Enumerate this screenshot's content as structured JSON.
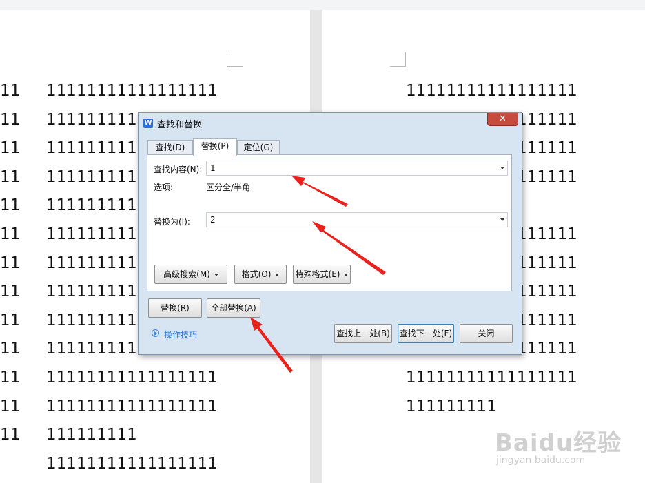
{
  "document": {
    "left_page_lines": [
      {
        "prefix": "11",
        "text": "11111111111111111"
      },
      {
        "prefix": "11",
        "text": "11111111111111111"
      },
      {
        "prefix": "11",
        "text": "11111111111111111"
      },
      {
        "prefix": "11",
        "text": "11111111111111111"
      },
      {
        "prefix": "11",
        "text": "11111111111111111"
      },
      {
        "prefix": "11",
        "text": "11111111111111111"
      },
      {
        "prefix": "11",
        "text": "11111111111111111"
      },
      {
        "prefix": "11",
        "text": "11111111111111111"
      },
      {
        "prefix": "11",
        "text": "11111111111111111"
      },
      {
        "prefix": "11",
        "text": "11111111111111111"
      },
      {
        "prefix": "11",
        "text": "11111111111111111"
      },
      {
        "prefix": "11",
        "text": "11111111111111111"
      },
      {
        "prefix": "11",
        "text": "111111111"
      },
      {
        "prefix": "",
        "text": "11111111111111111"
      }
    ],
    "right_page_lines": [
      "11111111111111111",
      "11111111111111111",
      "11111111111111111",
      "11111111111111111",
      "",
      "11111111111111111",
      "11111111111111111",
      "11111111111111111",
      "11111111111111111",
      "11111111111111111",
      "11111111111111111",
      "111111111"
    ]
  },
  "dialog": {
    "title": "查找和替换",
    "close_glyph": "✕",
    "tabs": [
      {
        "label": "查找(D)"
      },
      {
        "label": "替换(P)"
      },
      {
        "label": "定位(G)"
      }
    ],
    "find_label": "查找内容(N):",
    "find_value": "1",
    "options_label": "选项:",
    "options_value": "区分全/半角",
    "replace_label": "替换为(I):",
    "replace_value": "2",
    "advanced_search_button": "高级搜索(M)",
    "format_button": "格式(O)",
    "special_format_button": "特殊格式(E)",
    "replace_button": "替换(R)",
    "replace_all_button": "全部替换(A)",
    "tips_link": "操作技巧",
    "find_previous_button": "查找上一处(B)",
    "find_next_button": "查找下一处(F)",
    "close_button": "关闭"
  },
  "watermark": {
    "logo": "Baidu经验",
    "sub": "jingyan.baidu.com"
  },
  "colors": {
    "arrow": "#e8231d",
    "dialog_bg": "#d7e4f2",
    "link": "#2f7bd0"
  }
}
